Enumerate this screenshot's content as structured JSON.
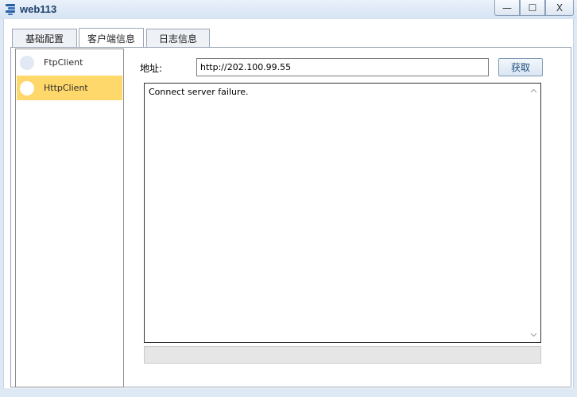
{
  "window": {
    "title": "web113",
    "icon": "app-logo-icon",
    "controls": {
      "minimize": "—",
      "maximize": "☐",
      "close": "X"
    }
  },
  "tabs": [
    {
      "label": "基础配置",
      "active": false
    },
    {
      "label": "客户端信息",
      "active": true
    },
    {
      "label": "日志信息",
      "active": false
    }
  ],
  "clients": [
    {
      "label": "FtpClient",
      "selected": false
    },
    {
      "label": "HttpClient",
      "selected": true
    }
  ],
  "form": {
    "address_label": "地址:",
    "address_value": "http://202.100.99.55",
    "fetch_label": "获取"
  },
  "output": {
    "text": "Connect server failure."
  },
  "colors": {
    "selected_item": "#ffd86b",
    "accent": "#1f4d7a"
  }
}
